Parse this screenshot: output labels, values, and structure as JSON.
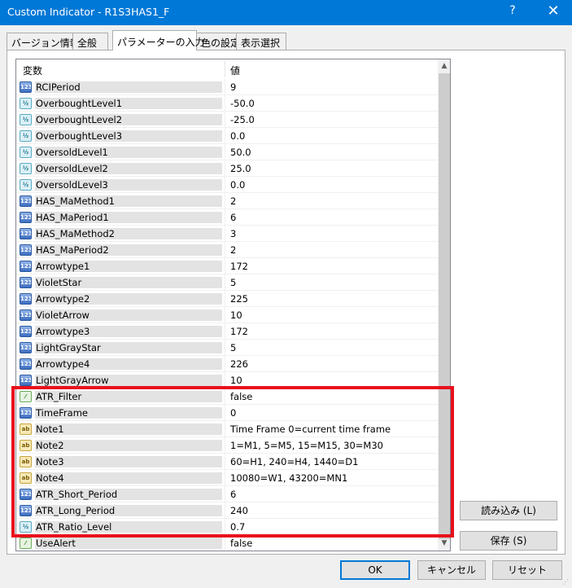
{
  "window": {
    "title": "Custom Indicator - R1S3HAS1_F",
    "help": "?",
    "close": "✕"
  },
  "tabs": [
    {
      "label": "バージョン情報"
    },
    {
      "label": "全般"
    },
    {
      "label": "パラメーターの入力"
    },
    {
      "label": "色の設定"
    },
    {
      "label": "表示選択"
    }
  ],
  "grid": {
    "col_name": "変数",
    "col_value": "値",
    "rows": [
      {
        "type": "int",
        "icon": "123",
        "name": "RCIPeriod",
        "value": "9"
      },
      {
        "type": "dbl",
        "icon": "½",
        "name": "OverboughtLevel1",
        "value": "-50.0"
      },
      {
        "type": "dbl",
        "icon": "½",
        "name": "OverboughtLevel2",
        "value": "-25.0"
      },
      {
        "type": "dbl",
        "icon": "½",
        "name": "OverboughtLevel3",
        "value": "0.0"
      },
      {
        "type": "dbl",
        "icon": "½",
        "name": "OversoldLevel1",
        "value": "50.0"
      },
      {
        "type": "dbl",
        "icon": "½",
        "name": "OversoldLevel2",
        "value": "25.0"
      },
      {
        "type": "dbl",
        "icon": "½",
        "name": "OversoldLevel3",
        "value": "0.0"
      },
      {
        "type": "int",
        "icon": "123",
        "name": "HAS_MaMethod1",
        "value": "2"
      },
      {
        "type": "int",
        "icon": "123",
        "name": "HAS_MaPeriod1",
        "value": "6"
      },
      {
        "type": "int",
        "icon": "123",
        "name": "HAS_MaMethod2",
        "value": "3"
      },
      {
        "type": "int",
        "icon": "123",
        "name": "HAS_MaPeriod2",
        "value": "2"
      },
      {
        "type": "int",
        "icon": "123",
        "name": "Arrowtype1",
        "value": "172"
      },
      {
        "type": "int",
        "icon": "123",
        "name": "VioletStar",
        "value": "5"
      },
      {
        "type": "int",
        "icon": "123",
        "name": "Arrowtype2",
        "value": "225"
      },
      {
        "type": "int",
        "icon": "123",
        "name": "VioletArrow",
        "value": "10"
      },
      {
        "type": "int",
        "icon": "123",
        "name": "Arrowtype3",
        "value": "172"
      },
      {
        "type": "int",
        "icon": "123",
        "name": "LightGrayStar",
        "value": "5"
      },
      {
        "type": "int",
        "icon": "123",
        "name": "Arrowtype4",
        "value": "226"
      },
      {
        "type": "int",
        "icon": "123",
        "name": "LightGrayArrow",
        "value": "10"
      },
      {
        "type": "bool",
        "icon": "⁄",
        "name": "ATR_Filter",
        "value": "false"
      },
      {
        "type": "int",
        "icon": "123",
        "name": "TimeFrame",
        "value": "0"
      },
      {
        "type": "str",
        "icon": "ab",
        "name": "Note1",
        "value": "Time Frame 0=current time frame"
      },
      {
        "type": "str",
        "icon": "ab",
        "name": "Note2",
        "value": "1=M1, 5=M5, 15=M15, 30=M30"
      },
      {
        "type": "str",
        "icon": "ab",
        "name": "Note3",
        "value": "60=H1, 240=H4, 1440=D1"
      },
      {
        "type": "str",
        "icon": "ab",
        "name": "Note4",
        "value": "10080=W1, 43200=MN1"
      },
      {
        "type": "int",
        "icon": "123",
        "name": "ATR_Short_Period",
        "value": "6"
      },
      {
        "type": "int",
        "icon": "123",
        "name": "ATR_Long_Period",
        "value": "240"
      },
      {
        "type": "dbl",
        "icon": "½",
        "name": "ATR_Ratio_Level",
        "value": "0.7"
      },
      {
        "type": "bool",
        "icon": "⁄",
        "name": "UseAlert",
        "value": "false"
      }
    ]
  },
  "side_buttons": {
    "load": "読み込み (L)",
    "save": "保存 (S)"
  },
  "footer_buttons": {
    "ok": "OK",
    "cancel": "キャンセル",
    "reset": "リセット"
  },
  "highlight_color": "#e8101c"
}
